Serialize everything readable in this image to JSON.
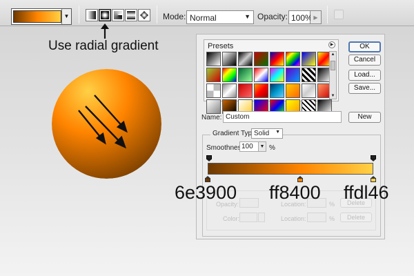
{
  "options_bar": {
    "gradient_colors": [
      "#6e3900",
      "#ff8400",
      "#ffd146"
    ],
    "types": [
      {
        "name": "linear",
        "active": false
      },
      {
        "name": "radial",
        "active": true
      },
      {
        "name": "angle",
        "active": false
      },
      {
        "name": "reflected",
        "active": false
      },
      {
        "name": "diamond",
        "active": false
      }
    ],
    "mode_label": "Mode:",
    "mode_value": "Normal",
    "opacity_label": "Opacity:",
    "opacity_value": "100%"
  },
  "annotation": {
    "text": "Use radial gradient"
  },
  "dialog": {
    "presets_title": "Presets",
    "preset_swatches": [
      "linear-gradient(135deg,#000,#fff)",
      "linear-gradient(135deg,#fff,#000)",
      "linear-gradient(135deg,#000,#ccc,#000)",
      "linear-gradient(135deg,#c00,#070)",
      "linear-gradient(135deg,#00c,#f00,#ff0)",
      "linear-gradient(135deg,#f00,#ff0,#0c0,#00f,#f0f)",
      "linear-gradient(135deg,#00f,#ff0)",
      "linear-gradient(135deg,#ff0,#f00,#ff0)",
      "linear-gradient(135deg,#9c3,#c00)",
      "linear-gradient(135deg,#f00,#ff0,#0f0,#00f)",
      "linear-gradient(135deg,#063,#9f9)",
      "linear-gradient(135deg,#f00,#fff,#00f)",
      "linear-gradient(135deg,#f0f,#0ff,#ff0)",
      "linear-gradient(135deg,#60c,#09f)",
      "repeating-linear-gradient(45deg,#000 0 3px,#fff 3px 6px)",
      "linear-gradient(135deg,#000,#fff)",
      "repeating-conic-gradient(#bbb 0 25%,#fff 0 50%)",
      "linear-gradient(135deg,#888,#fff,#888)",
      "linear-gradient(135deg,#c00,#f66)",
      "linear-gradient(135deg,#f90,#f00,#900)",
      "linear-gradient(135deg,#036,#09c,#6cf)",
      "linear-gradient(135deg,#fc0,#f60)",
      "linear-gradient(135deg,#fff,#ccc,#fff)",
      "linear-gradient(135deg,#f96,#c00)",
      "linear-gradient(135deg,#fff,#888)",
      "linear-gradient(135deg,#c60,#000)",
      "linear-gradient(135deg,#fff,#fc3)",
      "linear-gradient(135deg,#00f,#f00)",
      "linear-gradient(135deg,#f00,#00f,#0f0)",
      "linear-gradient(135deg,#ff0,#f90)",
      "repeating-linear-gradient(45deg,#000 0 2px,#fff 2px 5px)",
      "linear-gradient(135deg,#000,#fff)"
    ],
    "buttons": {
      "ok": "OK",
      "cancel": "Cancel",
      "load": "Load...",
      "save": "Save...",
      "new": "New"
    },
    "name_label": "Name:",
    "name_value": "Custom",
    "gradient_type_label": "Gradient Type:",
    "gradient_type_value": "Solid",
    "smoothness_label": "Smoothness:",
    "smoothness_value": "100",
    "smoothness_unit": "%",
    "color_stops": [
      {
        "hex": "6e3900",
        "color": "#6e3900",
        "location": 0
      },
      {
        "hex": "ff8400",
        "color": "#ff8400",
        "location": 0.56
      },
      {
        "hex": "ffdl46",
        "color": "#ffd146",
        "location": 1
      }
    ],
    "stops_section": {
      "opacity_label": "Opacity:",
      "location_label": "Location:",
      "color_label": "Color:",
      "location2_label": "Location:",
      "percent": "%",
      "delete_label": "Delete",
      "delete2_label": "Delete"
    }
  }
}
